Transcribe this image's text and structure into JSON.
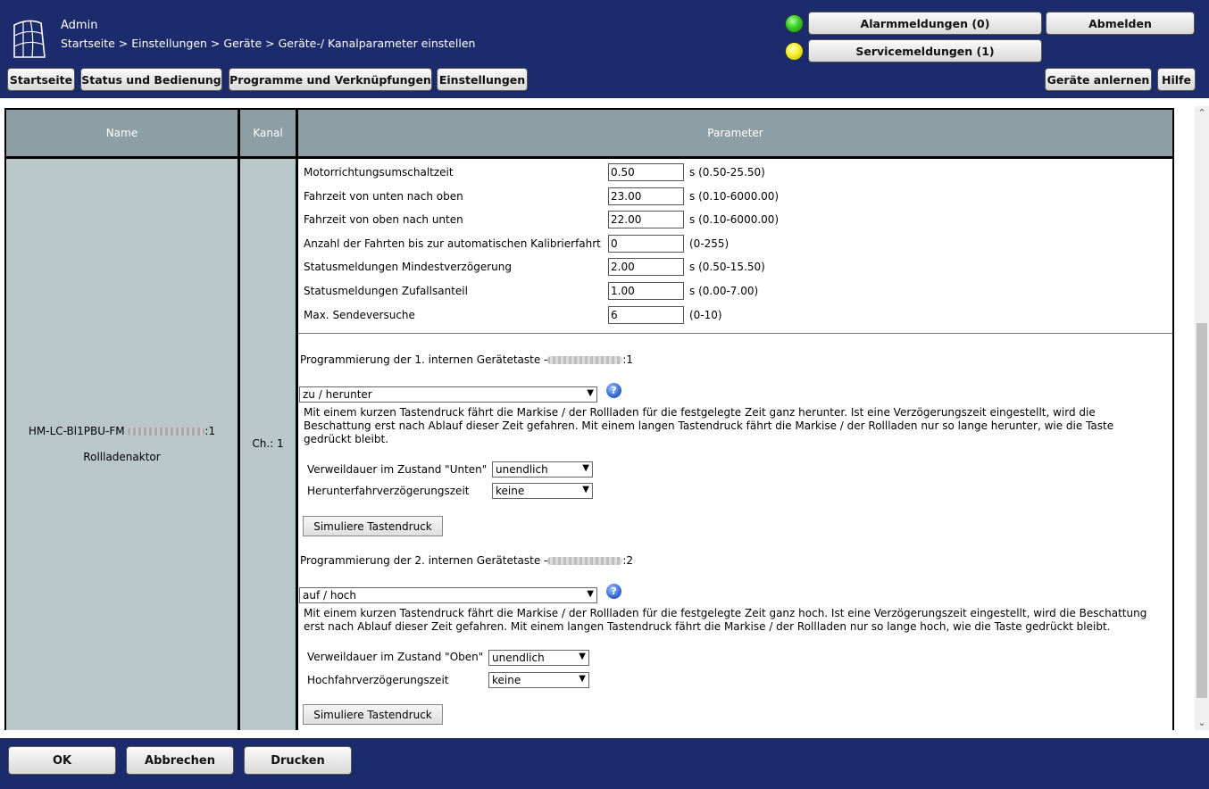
{
  "header": {
    "user": "Admin",
    "breadcrumb": "Startseite > Einstellungen > Geräte > Geräte-/ Kanalparameter einstellen",
    "alarm_button": "Alarmmeldungen (0)",
    "service_button": "Servicemeldungen (1)",
    "logout_button": "Abmelden",
    "alarm_led_color": "#3fd22d",
    "service_led_color": "#f4f02a",
    "nav": {
      "home": "Startseite",
      "status": "Status und Bedienung",
      "programs": "Programme und Verknüpfungen",
      "settings": "Einstellungen",
      "learn": "Geräte anlernen",
      "help": "Hilfe"
    }
  },
  "table": {
    "headers": {
      "name": "Name",
      "channel": "Kanal",
      "parameter": "Parameter"
    },
    "device": {
      "name": "HM-LC-Bl1PBU-FM",
      "name_suffix": ":1",
      "type": "Rollladenaktor",
      "channel": "Ch.: 1"
    },
    "params": [
      {
        "label": "Motorrichtungsumschaltzeit",
        "value": "0.50",
        "unit": "s (0.50-25.50)"
      },
      {
        "label": "Fahrzeit von unten nach oben",
        "value": "23.00",
        "unit": "s (0.10-6000.00)"
      },
      {
        "label": "Fahrzeit von oben nach unten",
        "value": "22.00",
        "unit": "s (0.10-6000.00)"
      },
      {
        "label": "Anzahl der Fahrten bis zur automatischen Kalibrierfahrt",
        "value": "0",
        "unit": " (0-255)"
      },
      {
        "label": "Statusmeldungen Mindestverzögerung",
        "value": "2.00",
        "unit": "s (0.50-15.50)"
      },
      {
        "label": "Statusmeldungen Zufallsanteil",
        "value": "1.00",
        "unit": "s (0.00-7.00)"
      },
      {
        "label": "Max. Sendeversuche",
        "value": "6",
        "unit": " (0-10)"
      }
    ],
    "key1": {
      "title": "Programmierung der 1. internen Gerätetaste -",
      "suffix": ":1",
      "mode": "zu / herunter",
      "description": "Mit einem kurzen Tastendruck fährt die Markise / der Rollladen für die festgelegte Zeit ganz herunter. Ist eine Verzögerungszeit eingestellt, wird die Beschattung erst nach Ablauf dieser Zeit gefahren. Mit einem langen Tastendruck fährt die Markise / der Rollladen nur so lange herunter, wie die Taste gedrückt bleibt.",
      "dwell_label": "Verweildauer im Zustand \"Unten\"",
      "dwell_value": "unendlich",
      "delay_label": "Herunterfahrverzögerungszeit",
      "delay_value": "keine",
      "simulate_button": "Simuliere Tastendruck"
    },
    "key2": {
      "title": "Programmierung der 2. internen Gerätetaste -",
      "suffix": ":2",
      "mode": "auf / hoch",
      "description": "Mit einem kurzen Tastendruck fährt die Markise / der Rollladen für die festgelegte Zeit ganz hoch. Ist eine Verzögerungszeit eingestellt, wird die Beschattung erst nach Ablauf dieser Zeit gefahren. Mit einem langen Tastendruck fährt die Markise / der Rollladen nur so lange hoch, wie die Taste gedrückt bleibt.",
      "dwell_label": "Verweildauer im Zustand \"Oben\"",
      "dwell_value": "unendlich",
      "delay_label": "Hochfahrverzögerungszeit",
      "delay_value": "keine",
      "simulate_button": "Simuliere Tastendruck"
    }
  },
  "footer": {
    "ok": "OK",
    "cancel": "Abbrechen",
    "print": "Drucken"
  }
}
